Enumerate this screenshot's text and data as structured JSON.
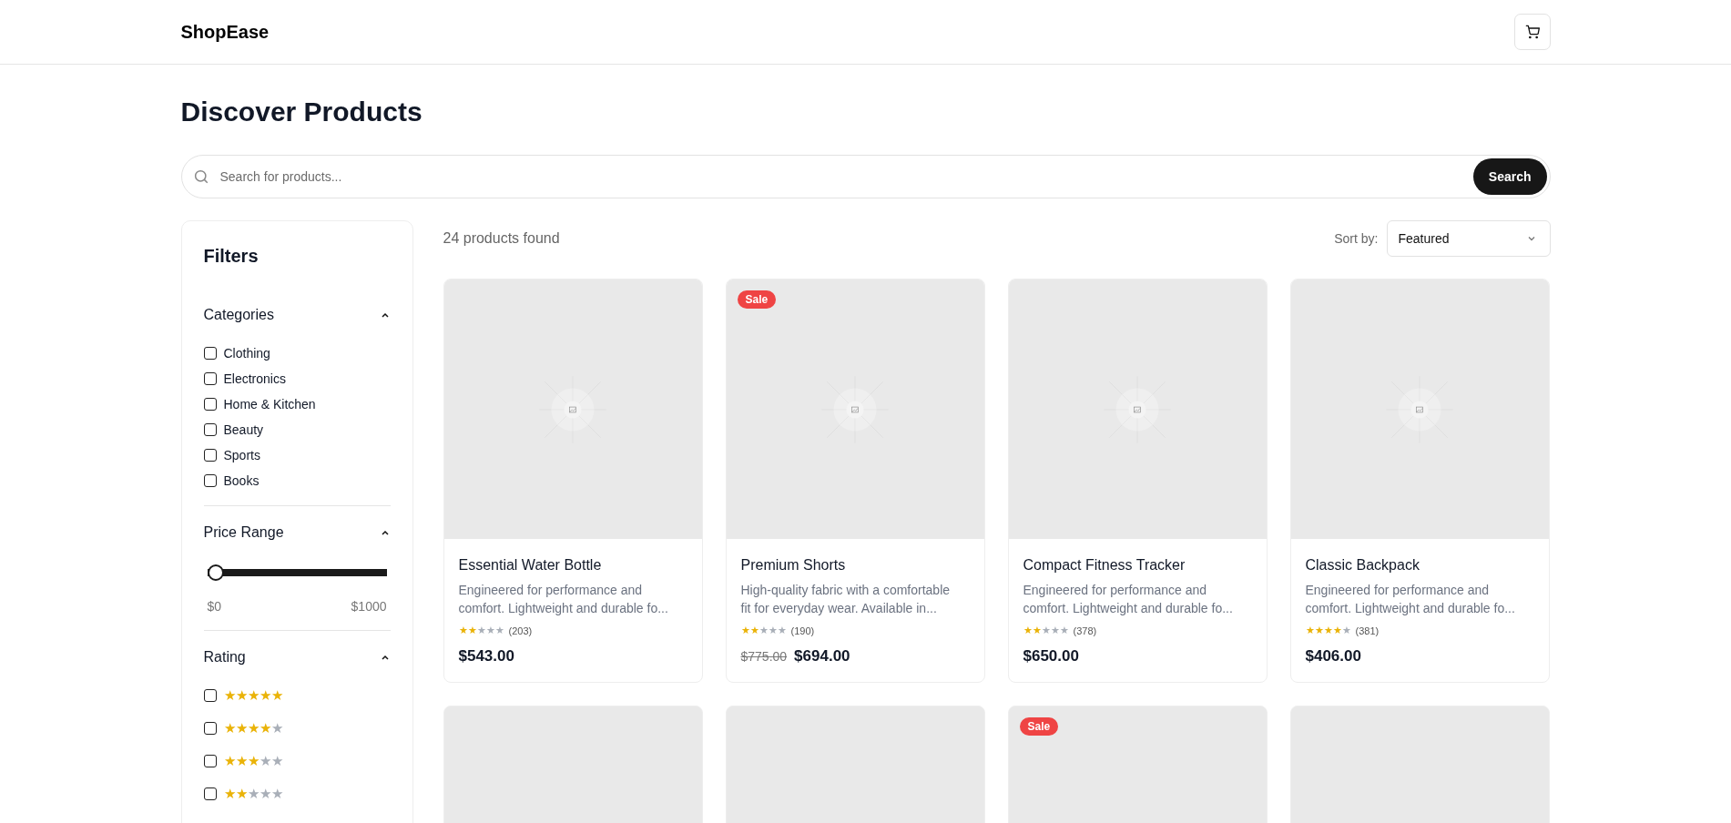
{
  "header": {
    "logo": "ShopEase"
  },
  "page_title": "Discover Products",
  "search": {
    "placeholder": "Search for products...",
    "button": "Search"
  },
  "filters": {
    "title": "Filters",
    "sections": [
      {
        "kind": "checklist",
        "title": "Categories",
        "expanded": true,
        "options": [
          {
            "label": "Clothing",
            "checked": false
          },
          {
            "label": "Electronics",
            "checked": false
          },
          {
            "label": "Home & Kitchen",
            "checked": false
          },
          {
            "label": "Beauty",
            "checked": false
          },
          {
            "label": "Sports",
            "checked": false
          },
          {
            "label": "Books",
            "checked": false
          }
        ]
      },
      {
        "kind": "range",
        "title": "Price Range",
        "expanded": true,
        "level": 0,
        "min_label": "$0",
        "max_label": "$1000"
      },
      {
        "kind": "rating",
        "title": "Rating",
        "expanded": true,
        "options": [
          {
            "stars": 5,
            "checked": false
          },
          {
            "stars": 4,
            "checked": false
          },
          {
            "stars": 3,
            "checked": false
          },
          {
            "stars": 2,
            "checked": false
          }
        ]
      }
    ]
  },
  "results": {
    "count": "24 products found",
    "sort_label": "Sort by:",
    "sort_value": "Featured"
  },
  "products": [
    {
      "name": "Essential Water Bottle",
      "sale": false,
      "description": "Engineered for performance and comfort. Lightweight and durable fo...",
      "stars": 2,
      "reviews": "(203)",
      "price": "$543.00"
    },
    {
      "name": "Premium Shorts",
      "sale": true,
      "sale_label": "Sale",
      "description": "High-quality fabric with a comfortable fit for everyday wear. Available in...",
      "stars": 2,
      "reviews": "(190)",
      "old_price": "$775.00",
      "price": "$694.00"
    },
    {
      "name": "Compact Fitness Tracker",
      "sale": false,
      "description": "Engineered for performance and comfort. Lightweight and durable fo...",
      "stars": 2,
      "reviews": "(378)",
      "price": "$650.00"
    },
    {
      "name": "Classic Backpack",
      "sale": false,
      "description": "Engineered for performance and comfort. Lightweight and durable fo...",
      "stars": 4,
      "reviews": "(381)",
      "price": "$406.00"
    }
  ],
  "more_products": [
    {
      "sale": false
    },
    {
      "sale": false
    },
    {
      "sale": true,
      "sale_label": "Sale"
    },
    {
      "sale": false
    }
  ]
}
